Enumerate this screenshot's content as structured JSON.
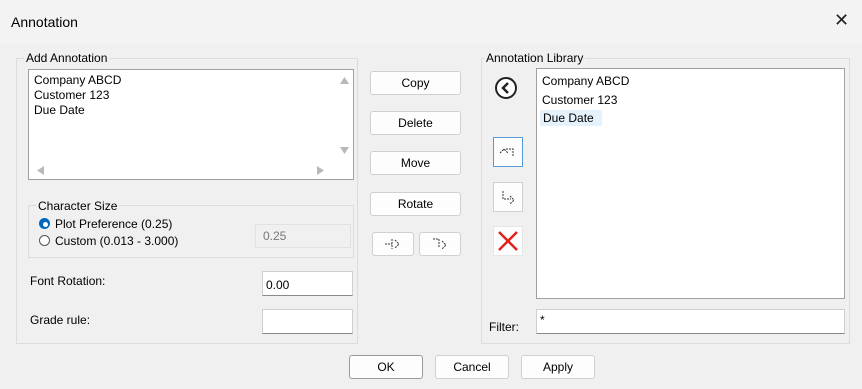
{
  "window": {
    "title": "Annotation",
    "close_glyph": "✕"
  },
  "add_annotation": {
    "legend": "Add Annotation",
    "lines": [
      "Company ABCD",
      "Customer 123",
      "Due Date"
    ]
  },
  "buttons": {
    "copy": "Copy",
    "delete": "Delete",
    "move": "Move",
    "rotate": "Rotate"
  },
  "character_size": {
    "legend": "Character Size",
    "plot_preference_label": "Plot Preference (0.25)",
    "custom_label": "Custom (0.013 - 3.000)",
    "custom_value": "0.25",
    "selected": "plot_preference"
  },
  "font_rotation": {
    "label": "Font Rotation:",
    "value": "0.00"
  },
  "grade_rule": {
    "label": "Grade rule:",
    "value": ""
  },
  "library": {
    "legend": "Annotation Library",
    "items": [
      "Company ABCD",
      "Customer 123",
      "Due Date"
    ],
    "selected_index": 2
  },
  "filter": {
    "label": "Filter:",
    "value": "*"
  },
  "footer": {
    "ok": "OK",
    "cancel": "Cancel",
    "apply": "Apply"
  },
  "colors": {
    "accent": "#0067c0",
    "delete_x": "#e0201b",
    "selection": "#e5f1fb"
  }
}
